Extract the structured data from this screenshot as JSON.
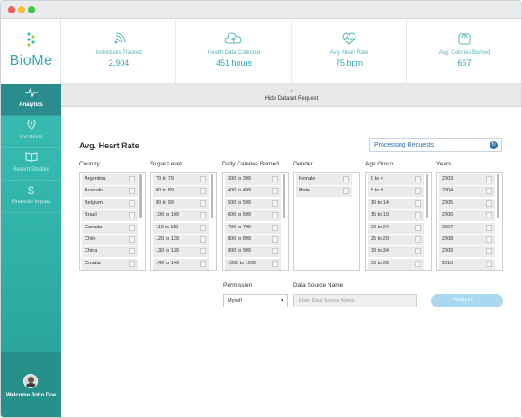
{
  "app": {
    "logo_text": "BioMe"
  },
  "sidebar": {
    "items": [
      {
        "label": "Analytics",
        "icon": "pulse-icon"
      },
      {
        "label": "Locations",
        "icon": "map-pin-icon"
      },
      {
        "label": "Recent Studies",
        "icon": "book-icon"
      },
      {
        "label": "Financial Impact",
        "icon": "dollar-icon"
      }
    ],
    "welcome": "Welcome John Doe"
  },
  "stats": [
    {
      "label": "Individuals Tracked",
      "value": "2,904",
      "icon": "signal-icon"
    },
    {
      "label": "Health Data Collected",
      "value": "451 hours",
      "icon": "cloud-upload-icon"
    },
    {
      "label": "Avg. Heart Rate",
      "value": "75 bpm",
      "icon": "heart-pulse-icon"
    },
    {
      "label": "Avg. Calories Burned",
      "value": "667",
      "icon": "scale-icon"
    }
  ],
  "hide_bar": {
    "label": "Hide Dataset Request"
  },
  "page": {
    "title": "Avg. Heart Rate",
    "processing_label": "Processing Requests"
  },
  "filters": {
    "country": {
      "header": "Country",
      "options": [
        "Argentina",
        "Australia",
        "Belgium",
        "Brazil",
        "Canada",
        "Chile",
        "China",
        "Croatia"
      ]
    },
    "sugar": {
      "header": "Sugar Level",
      "options": [
        "70 to 79",
        "80 to 89",
        "90 to 99",
        "100 to 109",
        "110 to 119",
        "120 to 129",
        "130 to 139",
        "140 to 149"
      ]
    },
    "calories": {
      "header": "Daily Calories Burned",
      "options": [
        "300 to 399",
        "400 to 499",
        "500 to 599",
        "600 to 699",
        "700 to 799",
        "800 to 899",
        "900 to 999",
        "1000 to 1099"
      ]
    },
    "gender": {
      "header": "Gender",
      "options": [
        "Female",
        "Male"
      ]
    },
    "age": {
      "header": "Age Group",
      "options": [
        "0 to 4",
        "5 to 9",
        "10 to 14",
        "15 to 19",
        "20 to 24",
        "25 to 29",
        "30 to 34",
        "35 to 39"
      ]
    },
    "years": {
      "header": "Years",
      "options": [
        "2003",
        "2004",
        "2005",
        "2006",
        "2007",
        "2008",
        "2009",
        "2010"
      ]
    }
  },
  "permission": {
    "label": "Permission",
    "value": "Myself"
  },
  "data_source": {
    "label": "Data Source Name",
    "placeholder": "Enter Data Source Name"
  },
  "analyze": {
    "label": "Analyze"
  }
}
